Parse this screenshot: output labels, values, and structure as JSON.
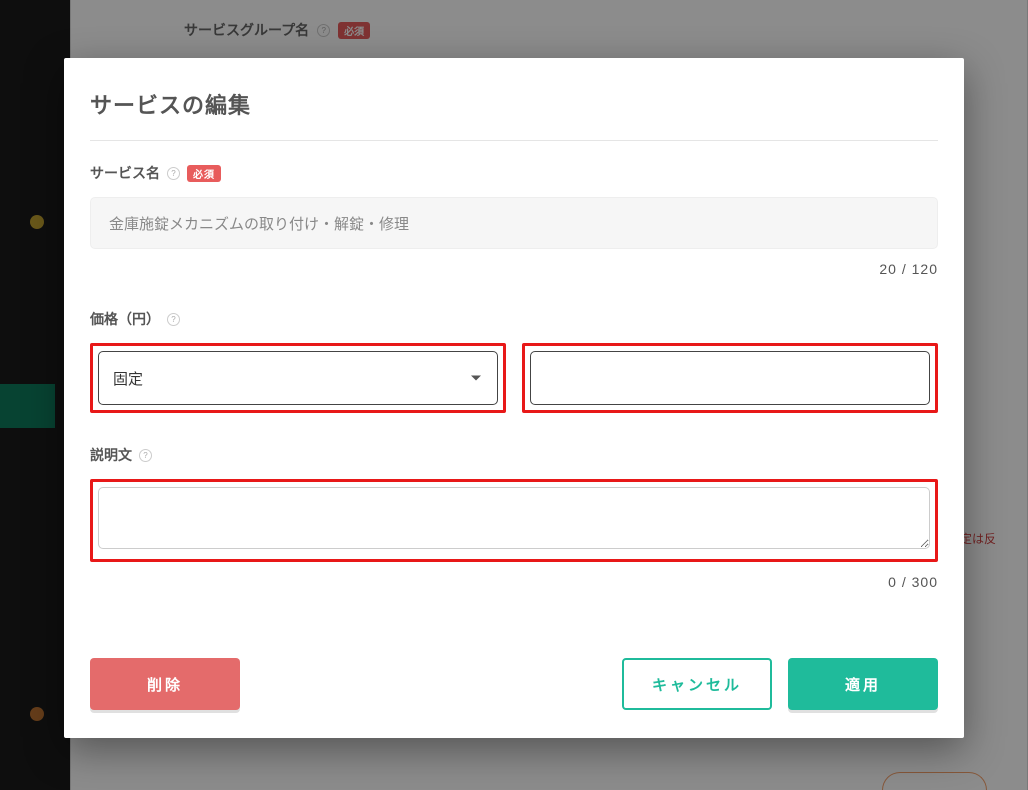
{
  "background": {
    "groupNameLabel": "サービスグループ名",
    "required": "必須",
    "warningFragment": "定は反"
  },
  "modal": {
    "title": "サービスの編集",
    "serviceName": {
      "label": "サービス名",
      "required": "必須",
      "value": "金庫施錠メカニズムの取り付け・解錠・修理",
      "counter": "20 / 120"
    },
    "price": {
      "label": "価格（円）",
      "selectValue": "固定",
      "inputValue": ""
    },
    "description": {
      "label": "説明文",
      "value": "",
      "counter": "0 / 300"
    },
    "buttons": {
      "delete": "削除",
      "cancel": "キャンセル",
      "apply": "適用"
    }
  }
}
